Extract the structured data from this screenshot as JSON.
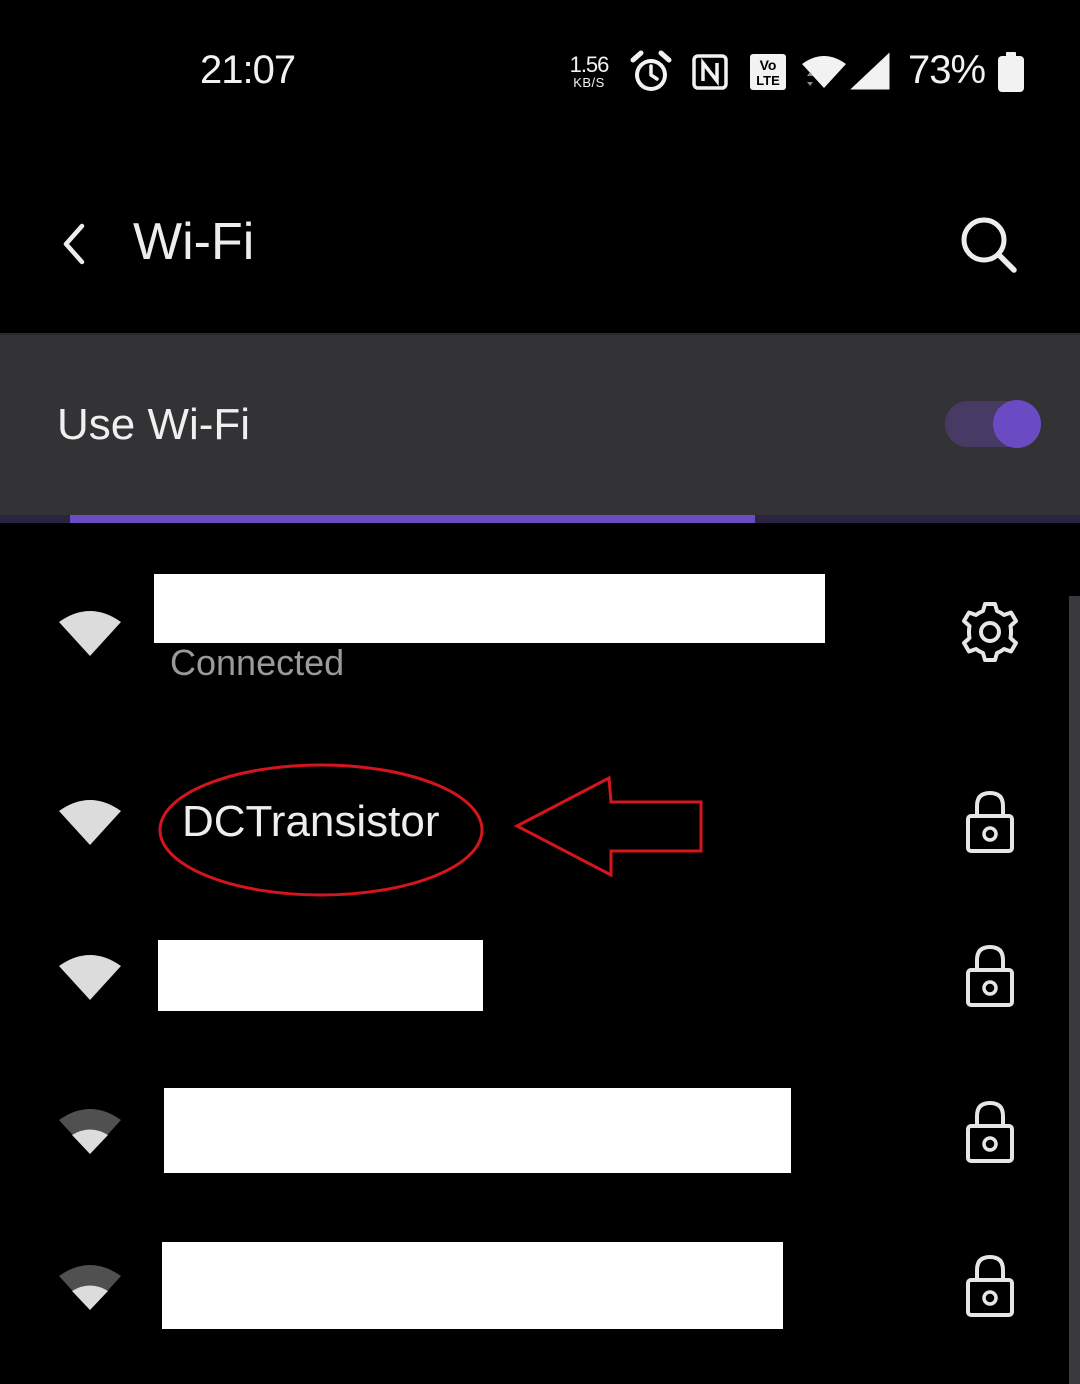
{
  "status_bar": {
    "time": "21:07",
    "net_speed_value": "1.56",
    "net_speed_unit": "KB/S",
    "icons": [
      "alarm-icon",
      "nfc-icon",
      "volte-icon",
      "wifi-signal-icon",
      "cell-signal-icon",
      "battery-icon"
    ],
    "volte_top": "Vo",
    "volte_bottom": "LTE",
    "battery_percent": "73%"
  },
  "header": {
    "title": "Wi-Fi",
    "back_icon": "chevron-left-icon",
    "search_icon": "search-icon"
  },
  "use_wifi": {
    "label": "Use Wi-Fi",
    "enabled": true,
    "accent": "#6a4dc3"
  },
  "networks": [
    {
      "ssid": "",
      "status": "Connected",
      "redacted": true,
      "strength": "full",
      "trailing_icon": "gear-icon"
    },
    {
      "ssid": "DCTransistor",
      "status": "",
      "redacted": false,
      "strength": "full",
      "trailing_icon": "lock-icon",
      "annotated": true
    },
    {
      "ssid": "",
      "status": "",
      "redacted": true,
      "strength": "full",
      "trailing_icon": "lock-icon"
    },
    {
      "ssid": "",
      "status": "",
      "redacted": true,
      "strength": "medium",
      "trailing_icon": "lock-icon"
    },
    {
      "ssid": "",
      "status": "",
      "redacted": true,
      "strength": "medium",
      "trailing_icon": "lock-icon"
    }
  ],
  "annotation": {
    "color": "#d4161c",
    "shapes": [
      "ellipse",
      "arrow"
    ]
  }
}
